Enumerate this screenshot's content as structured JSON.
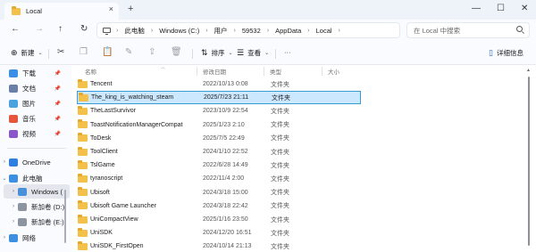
{
  "window": {
    "tab_title": "Local",
    "tab_close": "×",
    "new_tab": "+",
    "minimize": "—",
    "maximize": "☐",
    "close": "✕"
  },
  "nav": {
    "back": "←",
    "forward": "→",
    "up": "↑",
    "refresh": "↻"
  },
  "breadcrumb": [
    "此电脑",
    "Windows (C:)",
    "用户",
    "59532",
    "AppData",
    "Local"
  ],
  "breadcrumb_sep": "›",
  "search": {
    "placeholder": "在 Local 中搜索"
  },
  "toolbar": {
    "new_label": "新建",
    "new_glyph": "⊕",
    "sort_label": "排序",
    "sort_glyph": "⇅",
    "view_label": "查看",
    "view_glyph": "☰",
    "more": "···",
    "details_label": "详细信息",
    "details_glyph": "▯",
    "caret": "⌄",
    "cut": "✂",
    "copy": "❐",
    "paste": "📋",
    "rename": "✎",
    "share": "⇪",
    "delete": "🗑"
  },
  "sidebar": {
    "quick": [
      {
        "label": "下载",
        "pin": "📌",
        "color": "#3a8ee6"
      },
      {
        "label": "文档",
        "pin": "📌",
        "color": "#6a7fa8"
      },
      {
        "label": "图片",
        "pin": "📌",
        "color": "#4aa3df"
      },
      {
        "label": "音乐",
        "pin": "📌",
        "color": "#e4573c"
      },
      {
        "label": "视频",
        "pin": "📌",
        "color": "#8a56c9"
      }
    ],
    "tree": [
      {
        "label": "OneDrive",
        "chev": "›",
        "color": "#2f7fe0"
      },
      {
        "label": "此电脑",
        "chev": "⌄",
        "color": "#3d8fe0"
      },
      {
        "label": "Windows (",
        "chev": "›",
        "color": "#4a90d9"
      },
      {
        "label": "新加卷 (D:)",
        "chev": "›",
        "color": "#8c959f"
      },
      {
        "label": "新加卷 (E:)",
        "chev": "›",
        "color": "#8c959f"
      },
      {
        "label": "网络",
        "chev": "›",
        "color": "#3d8fe0"
      }
    ]
  },
  "columns": {
    "name": "名称",
    "date": "修改日期",
    "type": "类型",
    "size": "大小"
  },
  "files": [
    {
      "name": "Tencent",
      "date": "2022/10/13 0:08",
      "type": "文件夹"
    },
    {
      "name": "The_king_is_watching_steam",
      "date": "2025/7/23 21:11",
      "type": "文件夹"
    },
    {
      "name": "TheLastSurvivor",
      "date": "2023/10/9 22:54",
      "type": "文件夹"
    },
    {
      "name": "ToastNotificationManagerCompat",
      "date": "2025/1/23 2:10",
      "type": "文件夹"
    },
    {
      "name": "ToDesk",
      "date": "2025/7/5 22:49",
      "type": "文件夹"
    },
    {
      "name": "ToolClient",
      "date": "2024/1/10 22:52",
      "type": "文件夹"
    },
    {
      "name": "TslGame",
      "date": "2022/6/28 14:49",
      "type": "文件夹"
    },
    {
      "name": "tyranoscript",
      "date": "2022/11/4 2:00",
      "type": "文件夹"
    },
    {
      "name": "Ubisoft",
      "date": "2024/3/18 15:00",
      "type": "文件夹"
    },
    {
      "name": "Ubisoft Game Launcher",
      "date": "2024/3/18 22:42",
      "type": "文件夹"
    },
    {
      "name": "UniCompactView",
      "date": "2025/1/16 23:50",
      "type": "文件夹"
    },
    {
      "name": "UniSDK",
      "date": "2024/12/20 16:51",
      "type": "文件夹"
    },
    {
      "name": "UniSDK_FirstOpen",
      "date": "2024/10/14 21:13",
      "type": "文件夹"
    }
  ],
  "selected_index": 1
}
